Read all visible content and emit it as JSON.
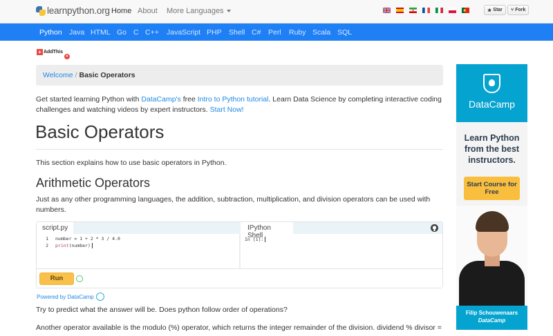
{
  "header": {
    "logo_text": "learnpython.org",
    "nav": [
      {
        "label": "Home"
      },
      {
        "label": "About"
      },
      {
        "label": "More Languages"
      }
    ],
    "flags": [
      "gb-flag-icon",
      "es-flag-icon",
      "ir-flag-icon",
      "fr-flag-icon",
      "it-flag-icon",
      "pl-flag-icon",
      "pt-flag-icon"
    ],
    "star_label": "Star",
    "fork_label": "Fork"
  },
  "languages": [
    "Python",
    "Java",
    "HTML",
    "Go",
    "C",
    "C++",
    "JavaScript",
    "PHP",
    "Shell",
    "C#",
    "Perl",
    "Ruby",
    "Scala",
    "SQL"
  ],
  "addthis_label": "AddThis",
  "breadcrumb": {
    "link": "Welcome",
    "sep": "/",
    "current": "Basic Operators"
  },
  "intro": {
    "t1": "Get started learning Python with ",
    "l1": "DataCamp's",
    "t2": " free ",
    "l2": "Intro to Python tutorial",
    "t3": ". Learn Data Science by completing interactive coding challenges and watching videos by expert instructors. ",
    "l3": "Start Now!"
  },
  "page_title": "Basic Operators",
  "section_intro": "This section explains how to use basic operators in Python.",
  "section_heading": "Arithmetic Operators",
  "arith_text": "Just as any other programming languages, the addition, subtraction, multiplication, and division operators can be used with numbers.",
  "widget": {
    "editor_tab": "script.py",
    "shell_tab": "IPython Shell",
    "lines": [
      {
        "n": "1",
        "code": "number = 1 + 2 * 3 / 4.0"
      },
      {
        "n": "2",
        "pre": "",
        "fn": "print",
        "post": "(number)"
      }
    ],
    "prompt": "In [1]:",
    "run_label": "Run"
  },
  "powered_by": "Powered by DataCamp",
  "question": "Try to predict what the answer will be. Does python follow order of operations?",
  "modulo_text": "Another operator available is the modulo (%) operator, which returns the integer remainder of the division. dividend % divisor =",
  "ad": {
    "brand": "DataCamp",
    "tagline": "Learn Python from the best instructors.",
    "cta": "Start Course for Free",
    "person": "Filip Schouwenaars",
    "person_org": "DataCamp"
  }
}
